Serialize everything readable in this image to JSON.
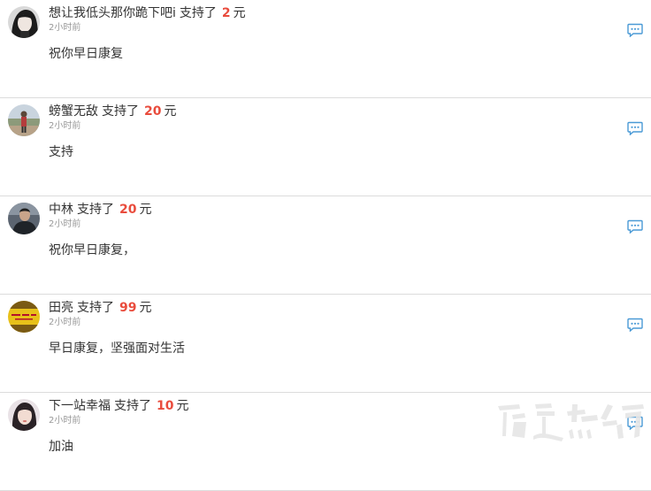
{
  "comments": [
    {
      "name": "想让我低头那你跪下吧i",
      "support_text": "支持了",
      "amount": "2",
      "unit": "元",
      "time": "2小时前",
      "message": "祝你早日康复",
      "avatar_icon": "avatar-girl-icon"
    },
    {
      "name": "螃蟹无敌",
      "support_text": "支持了",
      "amount": "20",
      "unit": "元",
      "time": "2小时前",
      "message": "支持",
      "avatar_icon": "avatar-outdoor-person-icon"
    },
    {
      "name": "中林",
      "support_text": "支持了",
      "amount": "20",
      "unit": "元",
      "time": "2小时前",
      "message": "祝你早日康复，",
      "avatar_icon": "avatar-man-icon"
    },
    {
      "name": "田亮",
      "support_text": "支持了",
      "amount": "99",
      "unit": "元",
      "time": "2小时前",
      "message": "早日康复，坚强面对生活",
      "avatar_icon": "avatar-yellow-banner-icon"
    },
    {
      "name": "下一站幸福",
      "support_text": "支持了",
      "amount": "10",
      "unit": "元",
      "time": "2小时前",
      "message": "加油",
      "avatar_icon": "avatar-woman-icon"
    }
  ],
  "watermark": "药速热线",
  "colors": {
    "amount": "#e94c3d",
    "reply_icon": "#4a9ad6",
    "divider": "#dcdcdc",
    "time": "#999999"
  }
}
